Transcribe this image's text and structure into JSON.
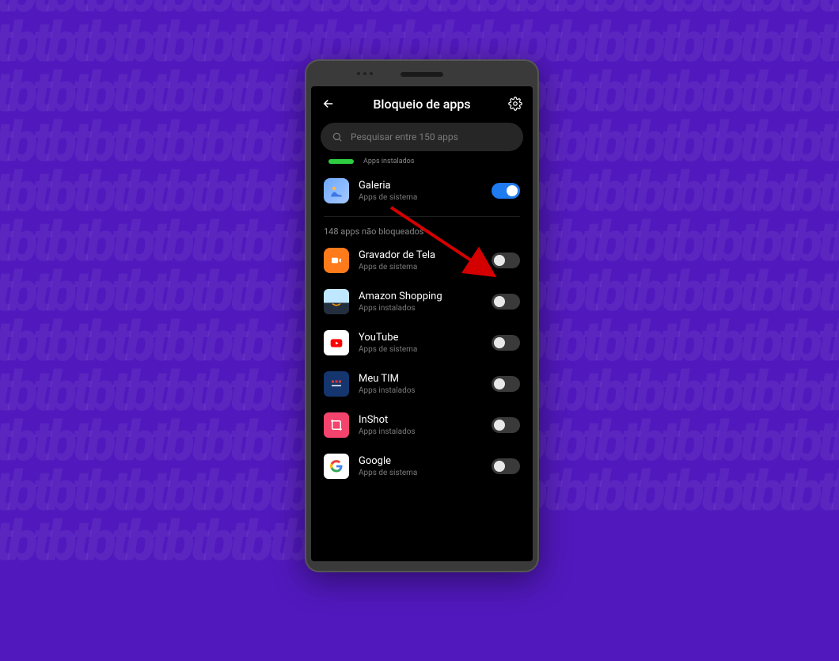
{
  "header": {
    "title": "Bloqueio de apps"
  },
  "search": {
    "placeholder": "Pesquisar entre 150 apps"
  },
  "cutoff_label": "Apps instalados",
  "locked": {
    "name": "Galeria",
    "sub": "Apps de sistema"
  },
  "section_label": "148 apps não bloqueados",
  "apps": [
    {
      "name": "Gravador de Tela",
      "sub": "Apps de sistema"
    },
    {
      "name": "Amazon Shopping",
      "sub": "Apps instalados"
    },
    {
      "name": "YouTube",
      "sub": "Apps de sistema"
    },
    {
      "name": "Meu TIM",
      "sub": "Apps instalados"
    },
    {
      "name": "InShot",
      "sub": "Apps instalados"
    },
    {
      "name": "Google",
      "sub": "Apps de sistema"
    }
  ]
}
